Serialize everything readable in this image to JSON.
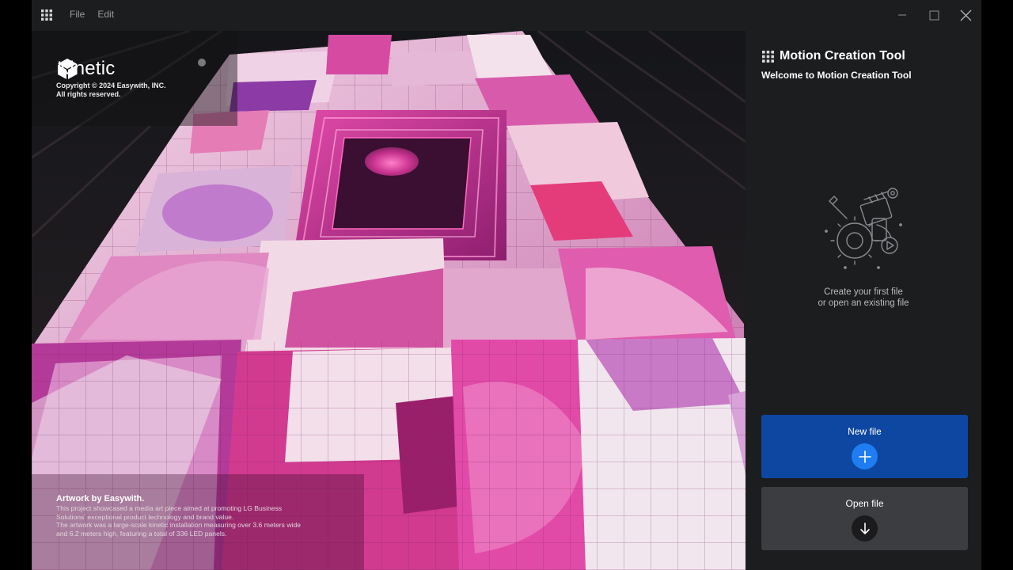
{
  "menu": {
    "file": "File",
    "edit": "Edit"
  },
  "brand": {
    "name": "Kinetic",
    "copyright_line1": "Copyright © 2024 Easywith, INC.",
    "copyright_line2": "All rights reserved."
  },
  "credit": {
    "title": "Artwork by Easywith.",
    "line1": "This project showcased a media art piece aimed at promoting LG Business",
    "line2": "Solutions' exceptional product technology and brand value.",
    "line3": "The artwork was a large-scale kinetic installation measuring over 3.6 meters wide",
    "line4": "and 6.2 meters high, featuring a total of 336 LED panels."
  },
  "panel": {
    "title": "Motion Creation Tool",
    "subtitle": "Welcome to Motion Creation Tool",
    "empty_line1": "Create your first file",
    "empty_line2": "or open an existing file",
    "new_file_label": "New file",
    "open_file_label": "Open file"
  },
  "colors": {
    "background": "#1c1d1f",
    "new_button": "#0d47a1",
    "new_button_circle": "#1e7df0",
    "open_button": "#3c3d40",
    "accent_magenta": "#c8338f"
  },
  "icons": {
    "app_menu": "grid-icon",
    "minimize": "minimize-icon",
    "maximize": "maximize-icon",
    "close": "close-icon",
    "brand": "cube-logo-icon",
    "new_file": "plus-icon",
    "open_file": "arrow-down-icon",
    "illustration": "creative-tools-illustration"
  }
}
